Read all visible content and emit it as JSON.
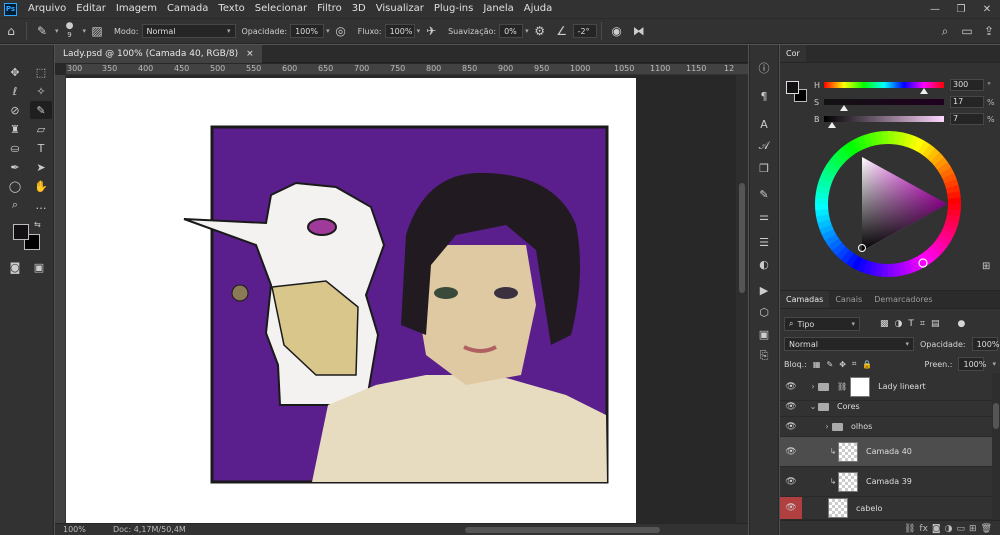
{
  "menubar": {
    "logo": "Ps",
    "items": [
      "Arquivo",
      "Editar",
      "Imagem",
      "Camada",
      "Texto",
      "Selecionar",
      "Filtro",
      "3D",
      "Visualizar",
      "Plug-ins",
      "Janela",
      "Ajuda"
    ],
    "minimize": "—",
    "maximize": "❐",
    "close": "✕"
  },
  "options": {
    "brush_size": "9",
    "mode_label": "Modo:",
    "mode_value": "Normal",
    "opacity_label": "Opacidade:",
    "opacity_value": "100%",
    "flow_label": "Fluxo:",
    "flow_value": "100%",
    "smoothing_label": "Suavização:",
    "smoothing_value": "0%",
    "angle_value": "-2°"
  },
  "document": {
    "tab_title": "Lady.psd @ 100% (Camada 40, RGB/8)",
    "tab_close": "×",
    "ruler_ticks": [
      "300",
      "350",
      "400",
      "450",
      "500",
      "550",
      "600",
      "650",
      "700",
      "750",
      "800",
      "850",
      "900",
      "950",
      "1000",
      "1050",
      "1100",
      "1150",
      "12"
    ],
    "zoom": "100%",
    "doc_info": "Doc: 4,17M/50,4M"
  },
  "color_panel": {
    "tab": "Cor",
    "h_label": "H",
    "h_value": "300",
    "h_unit": "°",
    "s_label": "S",
    "s_value": "17",
    "s_unit": "%",
    "b_label": "B",
    "b_value": "7",
    "b_unit": "%",
    "h_fraction": 0.833,
    "s_fraction": 0.17,
    "b_fraction": 0.07,
    "foreground_color": "#121012",
    "background_color": "#000000"
  },
  "layers_panel": {
    "tabs": [
      "Camadas",
      "Canais",
      "Demarcadores"
    ],
    "filter_label": "Tipo",
    "blend_mode": "Normal",
    "opacity_label": "Opacidade:",
    "opacity_value": "100%",
    "lock_label": "Bloq.:",
    "fill_label": "Preen.:",
    "fill_value": "100%",
    "layers": [
      {
        "name": "Lady lineart",
        "kind": "group",
        "indent": 0,
        "selected": false
      },
      {
        "name": "Cores",
        "kind": "group",
        "indent": 0,
        "selected": false
      },
      {
        "name": "olhos",
        "kind": "group",
        "indent": 1,
        "selected": false
      },
      {
        "name": "Camada 40",
        "kind": "layer",
        "indent": 1,
        "selected": true
      },
      {
        "name": "Camada 39",
        "kind": "layer",
        "indent": 1,
        "selected": false
      },
      {
        "name": "cabelo",
        "kind": "layer",
        "indent": 1,
        "selected": false
      }
    ]
  },
  "colors": {
    "accent": "#31a8ff",
    "artwork_background": "#5a1f8c"
  }
}
